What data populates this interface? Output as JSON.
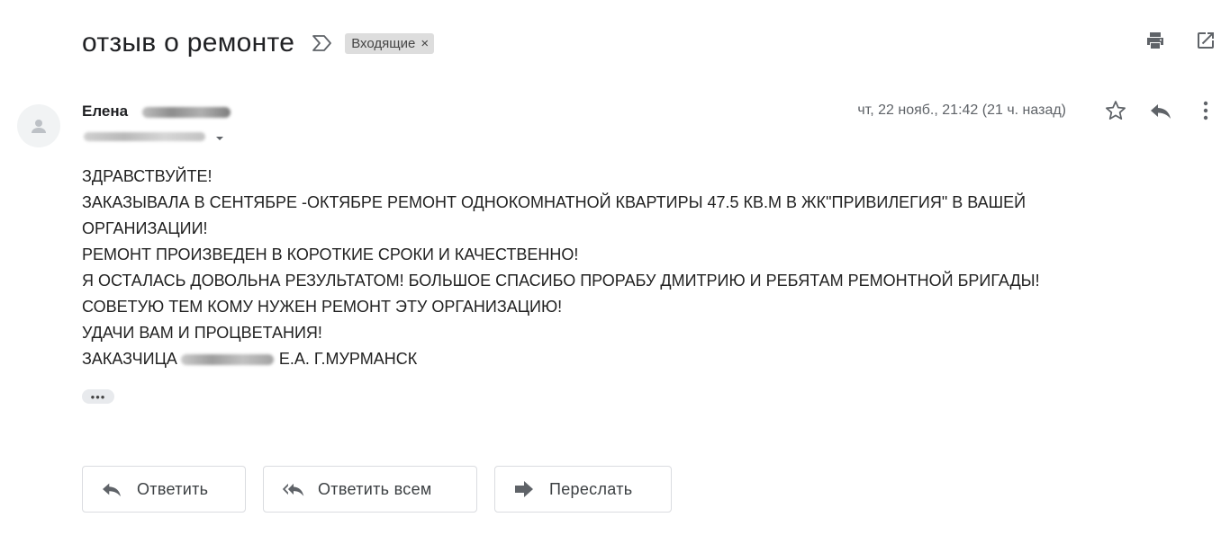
{
  "subject": "отзыв о ремонте",
  "label": {
    "text": "Входящие",
    "remove": "×"
  },
  "sender": {
    "name": "Елена"
  },
  "date": "чт, 22 нояб., 21:42 (21 ч. назад)",
  "body_lines": [
    "ЗДРАВСТВУЙТЕ!",
    "ЗАКАЗЫВАЛА В СЕНТЯБРЕ -ОКТЯБРЕ РЕМОНТ ОДНОКОМНАТНОЙ КВАРТИРЫ 47.5 КВ.М В ЖК\"ПРИВИЛЕГИЯ\" В ВАШЕЙ",
    "ОРГАНИЗАЦИИ!",
    "РЕМОНТ ПРОИЗВЕДЕН В КОРОТКИЕ СРОКИ И КАЧЕСТВЕННО!",
    "Я ОСТАЛАСЬ ДОВОЛЬНА РЕЗУЛЬТАТОМ! БОЛЬШОЕ СПАСИБО ПРОРАБУ ДМИТРИЮ И РЕБЯТАМ РЕМОНТНОЙ БРИГАДЫ!",
    "СОВЕТУЮ ТЕМ КОМУ НУЖЕН РЕМОНТ  ЭТУ ОРГАНИЗАЦИЮ!",
    "УДАЧИ ВАМ И ПРОЦВЕТАНИЯ!"
  ],
  "signature": {
    "prefix": "ЗАКАЗЧИЦА",
    "suffix": "Е.А. Г.МУРМАНСК"
  },
  "trimmed_indicator": "•••",
  "actions": {
    "reply": "Ответить",
    "reply_all": "Ответить всем",
    "forward": "Переслать"
  },
  "icons": {
    "importance": "importance-marker-icon",
    "print": "print-icon",
    "open_new_window": "open-in-new-window-icon",
    "avatar": "person-icon",
    "star": "star-icon",
    "reply": "reply-icon",
    "more": "more-vert-icon",
    "reply_all": "reply-all-icon",
    "forward": "forward-icon",
    "caret": "chevron-down-icon"
  },
  "colors": {
    "text": "#202124",
    "secondary": "#5f6368",
    "chip_bg": "#dddddd",
    "border": "#dadce0"
  }
}
